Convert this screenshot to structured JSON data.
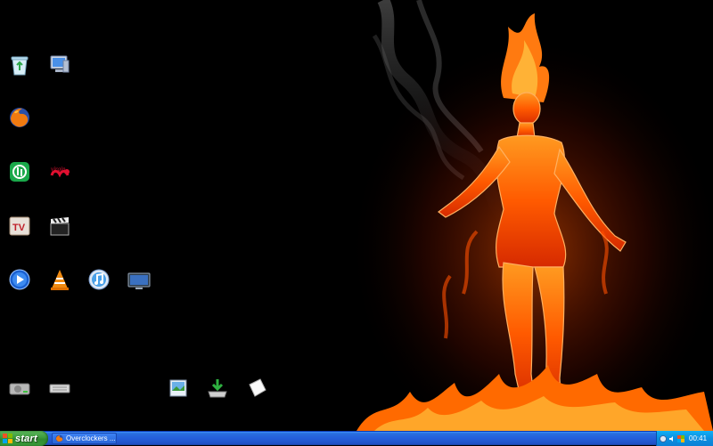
{
  "desktop": {
    "icons": [
      {
        "id": "recycle-bin",
        "icon": "recycle-bin-icon"
      },
      {
        "id": "my-computer",
        "icon": "computer-icon"
      },
      {
        "id": "firefox",
        "icon": "firefox-icon"
      },
      {
        "id": "bittorrent",
        "icon": "bittorrent-icon"
      },
      {
        "id": "virgin-media",
        "icon": "virgin-media-icon"
      },
      {
        "id": "tv-app",
        "icon": "tv-app-icon"
      },
      {
        "id": "clapperboard",
        "icon": "clapperboard-icon"
      },
      {
        "id": "media-player",
        "icon": "media-player-icon"
      },
      {
        "id": "vlc",
        "icon": "vlc-icon"
      },
      {
        "id": "itunes",
        "icon": "itunes-icon"
      },
      {
        "id": "monitor",
        "icon": "monitor-icon"
      },
      {
        "id": "hard-drive",
        "icon": "hard-drive-icon"
      },
      {
        "id": "network-device",
        "icon": "network-device-icon"
      },
      {
        "id": "image-viewer",
        "icon": "image-viewer-icon"
      },
      {
        "id": "downloader",
        "icon": "download-icon"
      },
      {
        "id": "blank-document",
        "icon": "blank-document-icon"
      }
    ]
  },
  "taskbar": {
    "start_label": "start",
    "task_button_label": "Overclockers ...",
    "task_button_icon": "firefox-icon",
    "tray_icons": [
      "network-icon",
      "volume-icon",
      "security-icon"
    ],
    "clock": "00:41"
  },
  "colors": {
    "start_green": "#3c9a3c",
    "taskbar_blue": "#245edb",
    "tray_blue": "#0d8fe0",
    "fire_orange": "#ff6a00"
  }
}
